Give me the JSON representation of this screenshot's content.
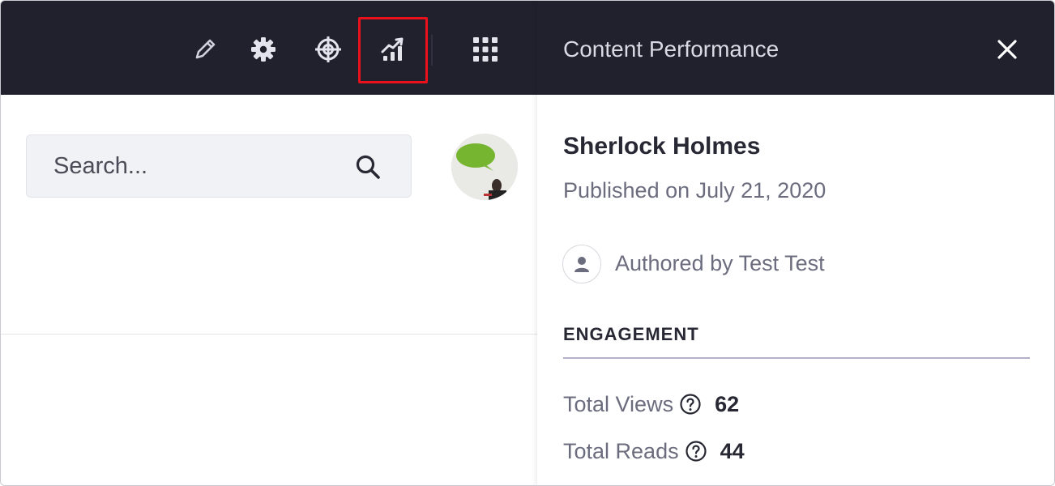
{
  "toolbar": {
    "icons": [
      "pencil-icon",
      "gear-icon",
      "target-icon",
      "chart-trend-icon",
      "grid-apps-icon"
    ],
    "highlight_color": "#e8111c",
    "background": "#20212d"
  },
  "search": {
    "placeholder": "Search..."
  },
  "panel": {
    "title": "Content Performance",
    "article_title": "Sherlock Holmes",
    "published": "Published on July 21, 2020",
    "author": "Authored by Test Test",
    "section": "ENGAGEMENT",
    "metrics": [
      {
        "label": "Total Views",
        "value": "62"
      },
      {
        "label": "Total Reads",
        "value": "44"
      }
    ]
  }
}
